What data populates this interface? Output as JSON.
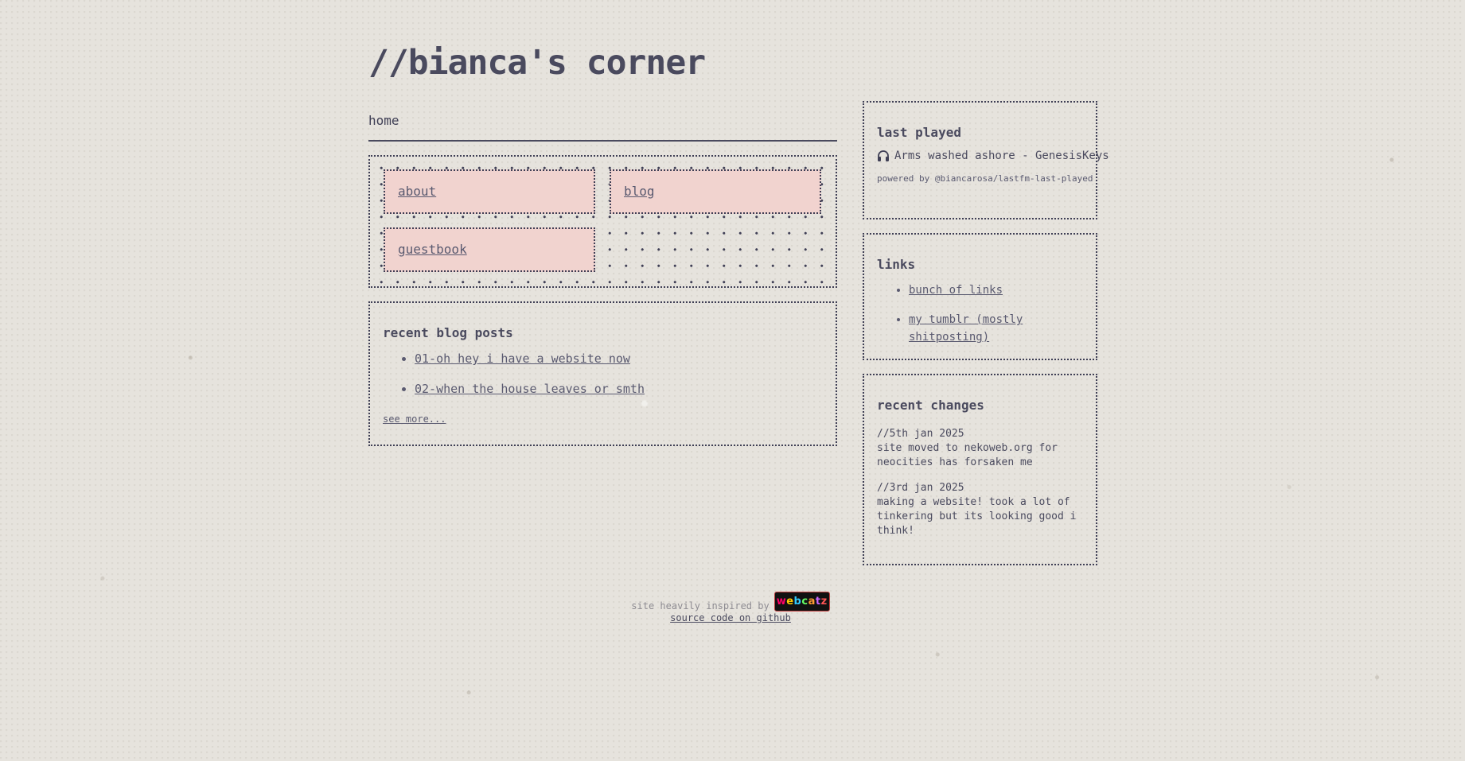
{
  "site": {
    "title": "//bianca's corner"
  },
  "nav": {
    "home_label": "home",
    "buttons": [
      {
        "label": "about"
      },
      {
        "label": "blog"
      },
      {
        "label": "guestbook"
      }
    ]
  },
  "blog": {
    "heading": "recent blog posts",
    "posts": [
      {
        "title": "01-oh hey i have a website now"
      },
      {
        "title": "02-when the house leaves or smth"
      }
    ],
    "see_more": "see more..."
  },
  "last_played": {
    "heading": "last played",
    "track": "Arms washed ashore - GenesisKeys",
    "icon": "headphones-icon",
    "powered_by": "powered by @biancarosa/lastfm-last-played"
  },
  "links": {
    "heading": "links",
    "items": [
      {
        "label": "bunch of links"
      },
      {
        "label": "my tumblr (mostly shitposting)"
      }
    ]
  },
  "changes": {
    "heading": "recent changes",
    "entries": [
      {
        "date": "//5th jan 2025",
        "text": "site moved to nekoweb.org for neocities has forsaken me"
      },
      {
        "date": "//3rd jan 2025",
        "text": "making a website! took a lot of tinkering but its looking good i think!"
      }
    ]
  },
  "footer": {
    "inspired_text": "site heavily inspired by",
    "badge_text": "webcatz",
    "source_link": "source code on github"
  },
  "colors": {
    "background": "#e6e3dd",
    "text": "#4a4a5e",
    "button_fill": "#f1d3cf"
  }
}
